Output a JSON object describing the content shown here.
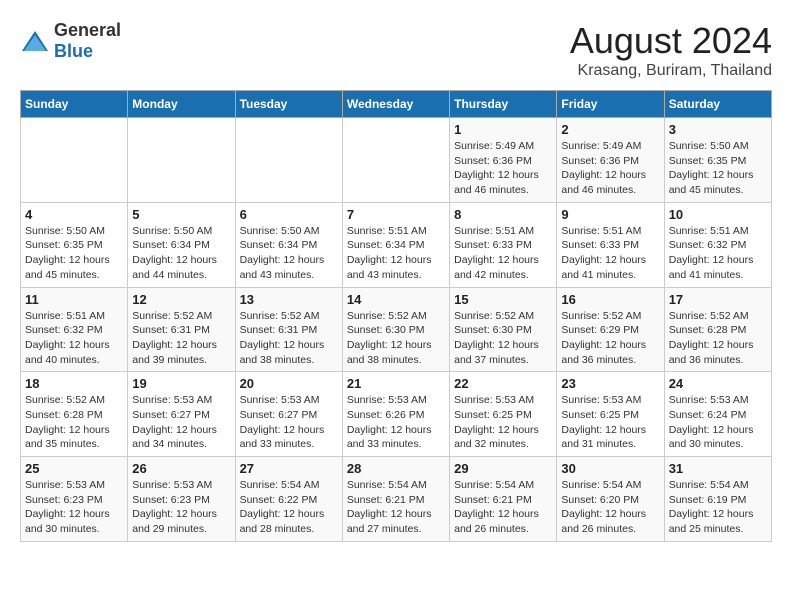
{
  "logo": {
    "general": "General",
    "blue": "Blue"
  },
  "title": "August 2024",
  "subtitle": "Krasang, Buriram, Thailand",
  "weekdays": [
    "Sunday",
    "Monday",
    "Tuesday",
    "Wednesday",
    "Thursday",
    "Friday",
    "Saturday"
  ],
  "weeks": [
    [
      {
        "day": "",
        "info": ""
      },
      {
        "day": "",
        "info": ""
      },
      {
        "day": "",
        "info": ""
      },
      {
        "day": "",
        "info": ""
      },
      {
        "day": "1",
        "info": "Sunrise: 5:49 AM\nSunset: 6:36 PM\nDaylight: 12 hours\nand 46 minutes."
      },
      {
        "day": "2",
        "info": "Sunrise: 5:49 AM\nSunset: 6:36 PM\nDaylight: 12 hours\nand 46 minutes."
      },
      {
        "day": "3",
        "info": "Sunrise: 5:50 AM\nSunset: 6:35 PM\nDaylight: 12 hours\nand 45 minutes."
      }
    ],
    [
      {
        "day": "4",
        "info": "Sunrise: 5:50 AM\nSunset: 6:35 PM\nDaylight: 12 hours\nand 45 minutes."
      },
      {
        "day": "5",
        "info": "Sunrise: 5:50 AM\nSunset: 6:34 PM\nDaylight: 12 hours\nand 44 minutes."
      },
      {
        "day": "6",
        "info": "Sunrise: 5:50 AM\nSunset: 6:34 PM\nDaylight: 12 hours\nand 43 minutes."
      },
      {
        "day": "7",
        "info": "Sunrise: 5:51 AM\nSunset: 6:34 PM\nDaylight: 12 hours\nand 43 minutes."
      },
      {
        "day": "8",
        "info": "Sunrise: 5:51 AM\nSunset: 6:33 PM\nDaylight: 12 hours\nand 42 minutes."
      },
      {
        "day": "9",
        "info": "Sunrise: 5:51 AM\nSunset: 6:33 PM\nDaylight: 12 hours\nand 41 minutes."
      },
      {
        "day": "10",
        "info": "Sunrise: 5:51 AM\nSunset: 6:32 PM\nDaylight: 12 hours\nand 41 minutes."
      }
    ],
    [
      {
        "day": "11",
        "info": "Sunrise: 5:51 AM\nSunset: 6:32 PM\nDaylight: 12 hours\nand 40 minutes."
      },
      {
        "day": "12",
        "info": "Sunrise: 5:52 AM\nSunset: 6:31 PM\nDaylight: 12 hours\nand 39 minutes."
      },
      {
        "day": "13",
        "info": "Sunrise: 5:52 AM\nSunset: 6:31 PM\nDaylight: 12 hours\nand 38 minutes."
      },
      {
        "day": "14",
        "info": "Sunrise: 5:52 AM\nSunset: 6:30 PM\nDaylight: 12 hours\nand 38 minutes."
      },
      {
        "day": "15",
        "info": "Sunrise: 5:52 AM\nSunset: 6:30 PM\nDaylight: 12 hours\nand 37 minutes."
      },
      {
        "day": "16",
        "info": "Sunrise: 5:52 AM\nSunset: 6:29 PM\nDaylight: 12 hours\nand 36 minutes."
      },
      {
        "day": "17",
        "info": "Sunrise: 5:52 AM\nSunset: 6:28 PM\nDaylight: 12 hours\nand 36 minutes."
      }
    ],
    [
      {
        "day": "18",
        "info": "Sunrise: 5:52 AM\nSunset: 6:28 PM\nDaylight: 12 hours\nand 35 minutes."
      },
      {
        "day": "19",
        "info": "Sunrise: 5:53 AM\nSunset: 6:27 PM\nDaylight: 12 hours\nand 34 minutes."
      },
      {
        "day": "20",
        "info": "Sunrise: 5:53 AM\nSunset: 6:27 PM\nDaylight: 12 hours\nand 33 minutes."
      },
      {
        "day": "21",
        "info": "Sunrise: 5:53 AM\nSunset: 6:26 PM\nDaylight: 12 hours\nand 33 minutes."
      },
      {
        "day": "22",
        "info": "Sunrise: 5:53 AM\nSunset: 6:25 PM\nDaylight: 12 hours\nand 32 minutes."
      },
      {
        "day": "23",
        "info": "Sunrise: 5:53 AM\nSunset: 6:25 PM\nDaylight: 12 hours\nand 31 minutes."
      },
      {
        "day": "24",
        "info": "Sunrise: 5:53 AM\nSunset: 6:24 PM\nDaylight: 12 hours\nand 30 minutes."
      }
    ],
    [
      {
        "day": "25",
        "info": "Sunrise: 5:53 AM\nSunset: 6:23 PM\nDaylight: 12 hours\nand 30 minutes."
      },
      {
        "day": "26",
        "info": "Sunrise: 5:53 AM\nSunset: 6:23 PM\nDaylight: 12 hours\nand 29 minutes."
      },
      {
        "day": "27",
        "info": "Sunrise: 5:54 AM\nSunset: 6:22 PM\nDaylight: 12 hours\nand 28 minutes."
      },
      {
        "day": "28",
        "info": "Sunrise: 5:54 AM\nSunset: 6:21 PM\nDaylight: 12 hours\nand 27 minutes."
      },
      {
        "day": "29",
        "info": "Sunrise: 5:54 AM\nSunset: 6:21 PM\nDaylight: 12 hours\nand 26 minutes."
      },
      {
        "day": "30",
        "info": "Sunrise: 5:54 AM\nSunset: 6:20 PM\nDaylight: 12 hours\nand 26 minutes."
      },
      {
        "day": "31",
        "info": "Sunrise: 5:54 AM\nSunset: 6:19 PM\nDaylight: 12 hours\nand 25 minutes."
      }
    ]
  ]
}
